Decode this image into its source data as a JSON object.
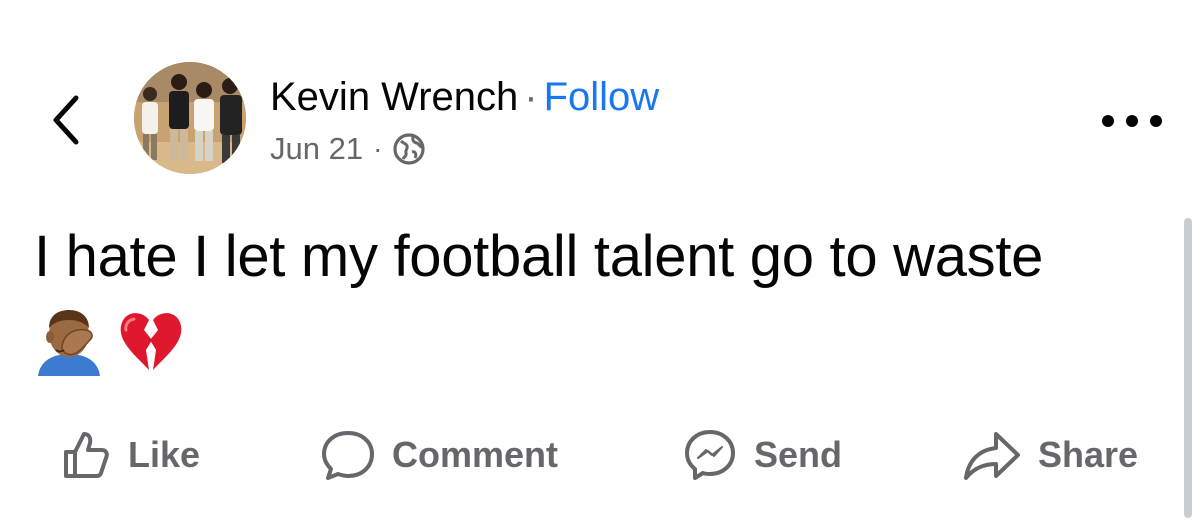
{
  "post": {
    "author": "Kevin Wrench",
    "separator": "·",
    "follow_label": "Follow",
    "date": "Jun 21",
    "meta_separator": "·",
    "privacy_icon": "globe-icon",
    "text": "I hate I let my football talent go to waste",
    "emojis": [
      "face-palm-emoji",
      "broken-heart-emoji"
    ]
  },
  "nav": {
    "back_icon": "chevron-left-icon",
    "more_icon": "more-horizontal-icon"
  },
  "actions": {
    "like_label": "Like",
    "comment_label": "Comment",
    "send_label": "Send",
    "share_label": "Share"
  },
  "colors": {
    "link": "#1877f2",
    "secondary_text": "#65676b",
    "text": "#050505"
  }
}
